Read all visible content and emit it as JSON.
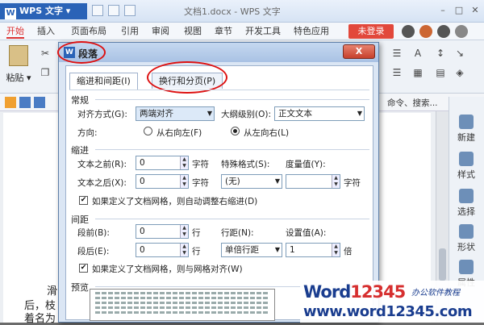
{
  "app": {
    "name": "WPS 文字",
    "doc_title": "文档1.docx - WPS 文字"
  },
  "menu": {
    "items": [
      "开始",
      "插入",
      "页面布局",
      "引用",
      "审阅",
      "视图",
      "章节",
      "开发工具",
      "特色应用"
    ],
    "login": "未登录"
  },
  "ribbon": {
    "paste": "粘贴",
    "right_text": "命令、搜索..."
  },
  "right_panel": [
    "新建",
    "样式",
    "选择",
    "形状",
    "属性"
  ],
  "doc_fragments": [
    "滑",
    "后，枝",
    "着名为"
  ],
  "dialog": {
    "title": "段落",
    "tabs": [
      "缩进和间距(I)",
      "换行和分页(P)"
    ],
    "general": {
      "section": "常规",
      "align_label": "对齐方式(G):",
      "align_value": "两端对齐",
      "outline_label": "大纲级别(O):",
      "outline_value": "正文文本",
      "direction_label": "方向:",
      "rtl_label": "从右向左(F)",
      "ltr_label": "从左向右(L)"
    },
    "indent": {
      "section": "缩进",
      "before_label": "文本之前(R):",
      "before_value": "0",
      "before_unit": "字符",
      "after_label": "文本之后(X):",
      "after_value": "0",
      "after_unit": "字符",
      "special_label": "特殊格式(S):",
      "special_value": "(无)",
      "measure_label": "度量值(Y):",
      "measure_value": "",
      "measure_unit": "字符",
      "auto_adjust_label": "如果定义了文档网格，则自动调整右缩进(D)"
    },
    "spacing": {
      "section": "间距",
      "before_label": "段前(B):",
      "before_value": "0",
      "before_unit": "行",
      "after_label": "段后(E):",
      "after_value": "0",
      "after_unit": "行",
      "line_label": "行距(N):",
      "line_value": "单倍行距",
      "setting_label": "设置值(A):",
      "setting_value": "1",
      "setting_unit": "倍",
      "grid_label": "如果定义了文档网格，则与网格对齐(W)"
    },
    "preview_label": "预览",
    "close": "X"
  },
  "watermark": {
    "brand_a": "Word",
    "brand_b": "12345",
    "tag": "办公软件教程",
    "url": "www.word12345.com"
  },
  "colors": {
    "accent": "#d33",
    "dialog_bg": "#dbe6f4",
    "annotation": "#d11"
  }
}
